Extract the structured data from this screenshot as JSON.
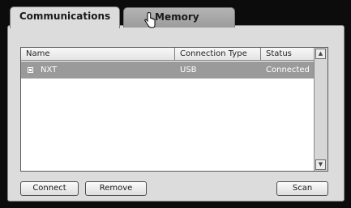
{
  "tabs": [
    {
      "label": "Communications",
      "active": true
    },
    {
      "label": "Memory",
      "active": false
    }
  ],
  "table": {
    "columns": [
      "Name",
      "Connection Type",
      "Status"
    ],
    "rows": [
      {
        "icon": "brick-icon",
        "name": "NXT",
        "connection_type": "USB",
        "status": "Connected",
        "selected": true
      }
    ]
  },
  "buttons": {
    "connect": "Connect",
    "remove": "Remove",
    "scan": "Scan"
  },
  "icons": {
    "scroll_up": "scroll-up-arrow-icon",
    "scroll_down": "scroll-down-arrow-icon",
    "cursor": "hand-pointer-icon"
  },
  "colors": {
    "selection": "#9a9a9a",
    "panel": "#dcdcdc",
    "background": "#0c0c0c"
  }
}
